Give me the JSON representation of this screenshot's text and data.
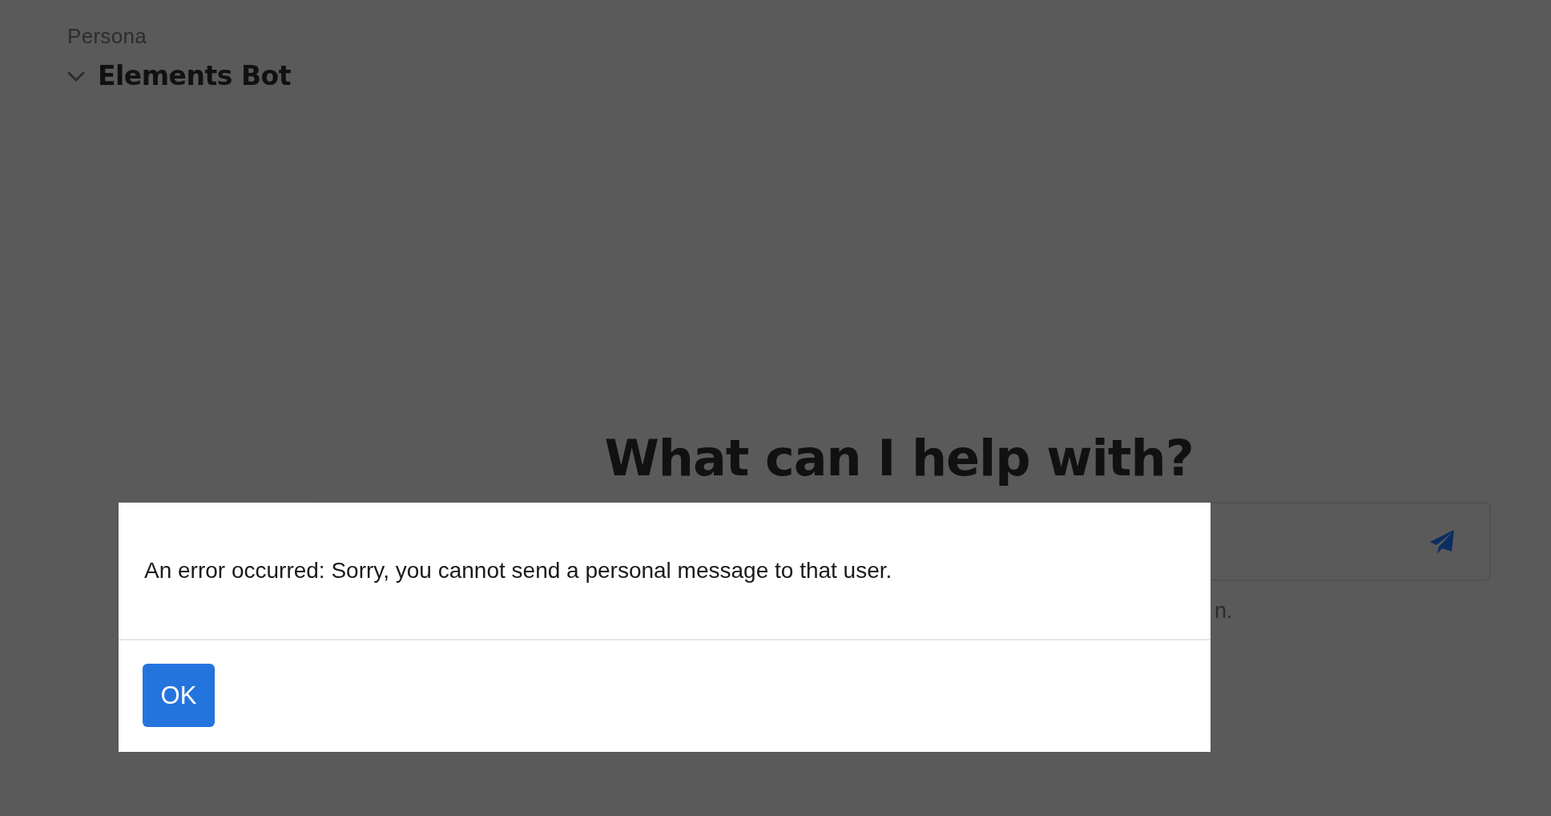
{
  "persona": {
    "label": "Persona",
    "name": "Elements Bot",
    "expanded": true
  },
  "main": {
    "heading": "What can I help with?",
    "hint": "n."
  },
  "dialog": {
    "message": "An error occurred: Sorry, you cannot send a personal message to that user.",
    "buttons": [
      "OK"
    ]
  }
}
